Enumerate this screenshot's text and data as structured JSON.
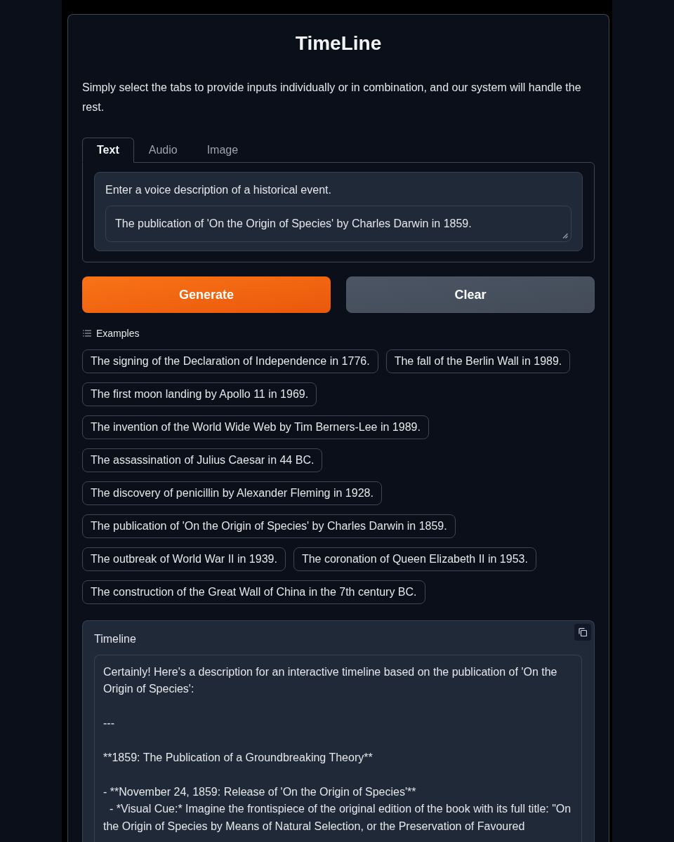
{
  "app": {
    "title": "TimeLine",
    "description": "Simply select the tabs to provide inputs individually or in combination, and our system will handle the rest."
  },
  "tabs": [
    {
      "label": "Text",
      "selected": true
    },
    {
      "label": "Audio",
      "selected": false
    },
    {
      "label": "Image",
      "selected": false
    }
  ],
  "input": {
    "label": "Enter a voice description of a historical event.",
    "value": "The publication of 'On the Origin of Species' by Charles Darwin in 1859."
  },
  "buttons": [
    {
      "label": "Generate",
      "kind": "primary"
    },
    {
      "label": "Clear",
      "kind": "secondary"
    }
  ],
  "examples": {
    "title": "Examples",
    "items": [
      "The signing of the Declaration of Independence in 1776.",
      "The fall of the Berlin Wall in 1989.",
      "The first moon landing by Apollo 11 in 1969.",
      "The invention of the World Wide Web by Tim Berners-Lee in 1989.",
      "The assassination of Julius Caesar in 44 BC.",
      "The discovery of penicillin by Alexander Fleming in 1928.",
      "The publication of 'On the Origin of Species' by Charles Darwin in 1859.",
      "The outbreak of World War II in 1939.",
      "The coronation of Queen Elizabeth II in 1953.",
      "The construction of the Great Wall of China in the 7th century BC."
    ]
  },
  "output": {
    "label": "Timeline",
    "value": "Certainly! Here's a description for an interactive timeline based on the publication of 'On the Origin of Species':\n\n---\n\n**1859: The Publication of a Groundbreaking Theory**\n\n- **November 24, 1859: Release of 'On the Origin of Species'**\n  - *Visual Cue:* Imagine the frontispiece of the original edition of the book with its full title: \"On the Origin of Species by Means of Natural Selection, or the Preservation of Favoured"
  }
}
